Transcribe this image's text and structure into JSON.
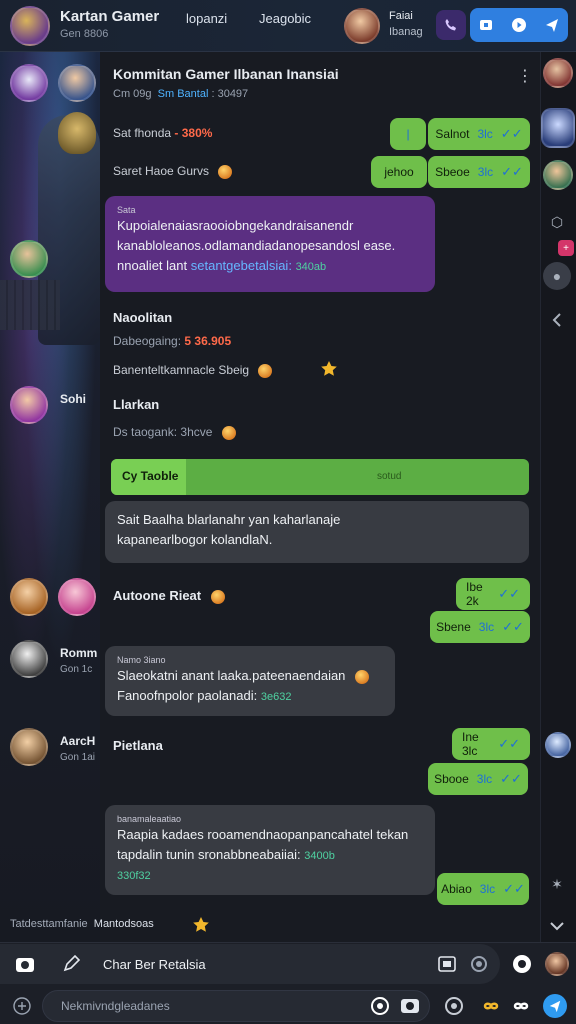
{
  "header": {
    "title": "Kartan Gamer",
    "subtitle": "Gen 8806",
    "tab_1": "lopanzi",
    "tab_2": "Jeagobic",
    "user_name": "Faiai",
    "user_sub": "Ibanag"
  },
  "sidebar": {
    "items": [
      {
        "name": "Sohi",
        "sub": ""
      },
      {
        "name": "Autoone Rieat",
        "sub": ""
      },
      {
        "name": "Romm",
        "sub": "Gon 1c"
      },
      {
        "name": "AarcH",
        "sub": "Gon 1ai"
      }
    ]
  },
  "chat": {
    "title": "Kommitan Gamer Ilbanan Inansiai",
    "meta_left": "Cm 09g",
    "meta_mid": "Sm Bantal",
    "meta_right": ": 30497",
    "lines": [
      {
        "label": "Sat fhonda",
        "value": "- 380%"
      },
      {
        "label": "Saret Haoe Gurvs",
        "value": ""
      }
    ],
    "outgoing_1": [
      {
        "text": "Salnot",
        "time": "3lc"
      },
      {
        "text": "jehoo",
        "time": ""
      },
      {
        "text": "Sbeoe",
        "time": "3lc"
      }
    ],
    "purple_bubble": {
      "label": "Sata",
      "line1": "Kupoialenaiasraooiobngekandraisanendr",
      "line2": "kanabloleanos.odlamandiadanopesandosl ease.",
      "line3": "nnoaliet lant",
      "link": "setantgebetalsiai:",
      "time": "340ab"
    },
    "section_1": {
      "sender": "Naoolitan",
      "line1_label": "Dabeogaing:",
      "line1_value": "5 36.905",
      "line2": "Banenteltkamnacle Sbeig"
    },
    "section_2": {
      "sender": "Llarkan",
      "line1_label": "Ds taogank:",
      "line1_value": "3hcve"
    },
    "progress": {
      "label": "Cy Taoble",
      "time": "sotud",
      "fraction": 0.18
    },
    "gray_bubble": {
      "line1": "Sait Baalha blarlanahr yan kaharlanaje",
      "line2": "kapanearlbogor kolandlaN."
    },
    "outgoing_2": [
      {
        "text": "Ibe 2k",
        "time": ""
      },
      {
        "text": "Sbene",
        "time": "3lc"
      }
    ],
    "gray_bubble_2": {
      "small": "Namo 3iano",
      "line1": "Slaeokatni anant laaka.pateenaendaian",
      "line2": "Fanoofnpolor paolanadi:",
      "time": "3e632"
    },
    "section_3": {
      "sender": "Pietlana"
    },
    "outgoing_3": [
      {
        "text": "Ine 3lc",
        "time": ""
      },
      {
        "text": "Sbooe",
        "time": "3lc"
      }
    ],
    "gray_bubble_3": {
      "small": "banamaleaatiao",
      "line1": "Raapia kadaes rooamendnaopanpancahatel tekan",
      "line2": "tapdalin tunin sronabbneabaiiai:",
      "time": "3400b",
      "line3": "330f32"
    },
    "outgoing_4": {
      "text": "Abiao",
      "time": "3lc"
    }
  },
  "footer": {
    "typing_left": "Tatdesttamfanie",
    "typing_right": "Mantodsoas",
    "composer_label": "Char Ber Retalsia",
    "input_placeholder": "Nekmivndgleadanes"
  },
  "icons": [
    "camera-icon",
    "pen-icon",
    "phone-icon",
    "video-icon",
    "play-icon",
    "send-icon",
    "chevron-down-icon",
    "chevron-left-icon",
    "image-icon",
    "smile-icon",
    "infinity-icon",
    "plus-icon"
  ],
  "colors": {
    "accent_blue": "#2f7fe0",
    "outgoing_green": "#6fbf4a",
    "purple_bubble": "#5b2f82",
    "incoming_gray": "#383b42",
    "time_red": "#ff6a4a",
    "time_teal": "#4fd1a1"
  }
}
